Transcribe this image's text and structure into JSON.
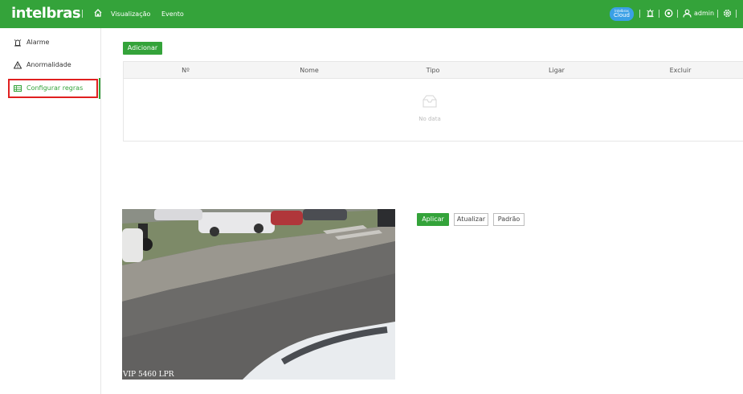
{
  "header": {
    "logo": "intelbras",
    "nav": [
      "Visualização",
      "Evento"
    ],
    "cloud": {
      "line1": "Intelbras",
      "line2": "Cloud"
    },
    "user": "admin",
    "colors": {
      "brand": "#34a33a",
      "cloud": "#3aa0e6"
    },
    "icons": [
      "home-icon",
      "alarm-icon",
      "status-icon",
      "user-icon",
      "settings-icon"
    ]
  },
  "sidebar": {
    "items": [
      {
        "label": "Alarme",
        "icon": "alarm-icon"
      },
      {
        "label": "Anormalidade",
        "icon": "warning-icon"
      },
      {
        "label": "Configurar regras",
        "icon": "rules-icon",
        "active": true
      }
    ]
  },
  "main": {
    "add_label": "Adicionar",
    "table": {
      "columns": [
        "Nº",
        "Nome",
        "Tipo",
        "Ligar",
        "Excluir"
      ],
      "rows": [],
      "empty_text": "No data"
    },
    "video_watermark": "VIP 5460 LPR",
    "actions": {
      "apply": "Aplicar",
      "refresh": "Atualizar",
      "default": "Padrão"
    }
  }
}
